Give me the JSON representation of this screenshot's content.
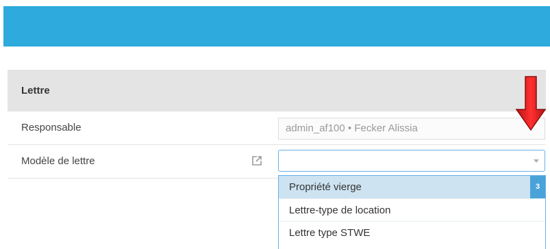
{
  "section": {
    "title": "Lettre"
  },
  "fields": {
    "responsable": {
      "label": "Responsable",
      "value": "admin_af100 • Fecker Alissia"
    },
    "modele": {
      "label": "Modèle de lettre",
      "value": ""
    }
  },
  "dropdown": {
    "count": "3",
    "options": [
      {
        "label": "Propriété vierge"
      },
      {
        "label": "Lettre-type de location"
      },
      {
        "label": "Lettre type STWE"
      }
    ]
  },
  "icons": {
    "external_link": "external-link-icon",
    "select_caret": "chevron-down-icon",
    "annotation_arrow": "red-arrow-icon"
  },
  "colors": {
    "banner": "#2eaadc",
    "header_bg": "#e4e4e4",
    "focus_border": "#66afe9",
    "highlight": "#cde3f1",
    "badge": "#4aa3d8",
    "arrow": "#e02020"
  }
}
